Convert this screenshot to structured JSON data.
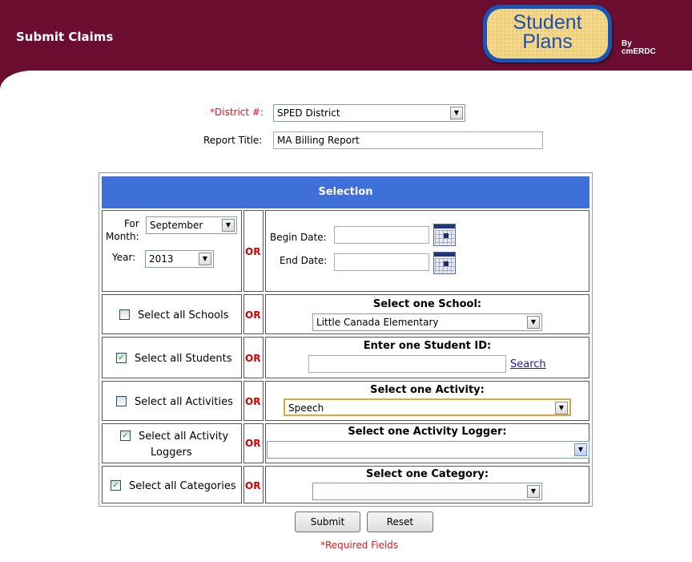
{
  "header": {
    "title": "Submit Claims",
    "logo_line1": "Student",
    "logo_line2": "Plans",
    "by_line1": "By",
    "by_line2": "cmERDC"
  },
  "form": {
    "district_label": "*District #:",
    "district_value": "SPED District",
    "report_title_label": "Report Title:",
    "report_title_value": "MA Billing Report"
  },
  "selection": {
    "header": "Selection",
    "or_text": "OR",
    "for_label": "For",
    "month_label": "Month:",
    "month_value": "September",
    "year_label": "Year:",
    "year_value": "2013",
    "begin_date_label": "Begin Date:",
    "begin_date_value": "",
    "end_date_label": "End Date:",
    "end_date_value": "",
    "rows": {
      "schools": {
        "checkbox_label": "Select all Schools",
        "checked": false,
        "title": "Select one School:",
        "value": "Little Canada Elementary"
      },
      "students": {
        "checkbox_label": "Select all Students",
        "checked": true,
        "title": "Enter one Student ID:",
        "value": "",
        "link": "Search"
      },
      "activities": {
        "checkbox_label": "Select all Activities",
        "checked": false,
        "title": "Select one Activity:",
        "value": "Speech"
      },
      "loggers": {
        "checkbox_label_1": "Select all Activity",
        "checkbox_label_2": "Loggers",
        "checked": true,
        "title": "Select one Activity Logger:",
        "value": ""
      },
      "categories": {
        "checkbox_label": "Select all Categories",
        "checked": true,
        "title": "Select one Category:",
        "value": ""
      }
    }
  },
  "buttons": {
    "submit": "Submit",
    "reset": "Reset"
  },
  "footer": {
    "required": "*Required Fields"
  },
  "icons": {
    "dropdown": "▼",
    "check": "✓"
  },
  "colors": {
    "header_bg": "#6b0d2f",
    "selection_bg": "#3f6fd8",
    "or_red": "#d40000",
    "required_red": "#e0161d"
  }
}
